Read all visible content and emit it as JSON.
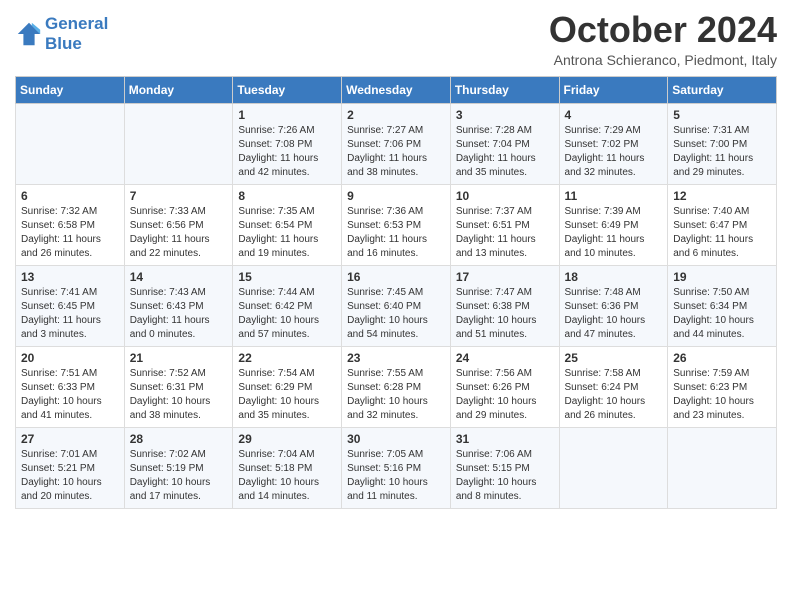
{
  "logo": {
    "line1": "General",
    "line2": "Blue"
  },
  "title": "October 2024",
  "subtitle": "Antrona Schieranco, Piedmont, Italy",
  "days_of_week": [
    "Sunday",
    "Monday",
    "Tuesday",
    "Wednesday",
    "Thursday",
    "Friday",
    "Saturday"
  ],
  "weeks": [
    [
      {
        "day": null,
        "sunrise": null,
        "sunset": null,
        "daylight": null
      },
      {
        "day": null,
        "sunrise": null,
        "sunset": null,
        "daylight": null
      },
      {
        "day": "1",
        "sunrise": "Sunrise: 7:26 AM",
        "sunset": "Sunset: 7:08 PM",
        "daylight": "Daylight: 11 hours and 42 minutes."
      },
      {
        "day": "2",
        "sunrise": "Sunrise: 7:27 AM",
        "sunset": "Sunset: 7:06 PM",
        "daylight": "Daylight: 11 hours and 38 minutes."
      },
      {
        "day": "3",
        "sunrise": "Sunrise: 7:28 AM",
        "sunset": "Sunset: 7:04 PM",
        "daylight": "Daylight: 11 hours and 35 minutes."
      },
      {
        "day": "4",
        "sunrise": "Sunrise: 7:29 AM",
        "sunset": "Sunset: 7:02 PM",
        "daylight": "Daylight: 11 hours and 32 minutes."
      },
      {
        "day": "5",
        "sunrise": "Sunrise: 7:31 AM",
        "sunset": "Sunset: 7:00 PM",
        "daylight": "Daylight: 11 hours and 29 minutes."
      }
    ],
    [
      {
        "day": "6",
        "sunrise": "Sunrise: 7:32 AM",
        "sunset": "Sunset: 6:58 PM",
        "daylight": "Daylight: 11 hours and 26 minutes."
      },
      {
        "day": "7",
        "sunrise": "Sunrise: 7:33 AM",
        "sunset": "Sunset: 6:56 PM",
        "daylight": "Daylight: 11 hours and 22 minutes."
      },
      {
        "day": "8",
        "sunrise": "Sunrise: 7:35 AM",
        "sunset": "Sunset: 6:54 PM",
        "daylight": "Daylight: 11 hours and 19 minutes."
      },
      {
        "day": "9",
        "sunrise": "Sunrise: 7:36 AM",
        "sunset": "Sunset: 6:53 PM",
        "daylight": "Daylight: 11 hours and 16 minutes."
      },
      {
        "day": "10",
        "sunrise": "Sunrise: 7:37 AM",
        "sunset": "Sunset: 6:51 PM",
        "daylight": "Daylight: 11 hours and 13 minutes."
      },
      {
        "day": "11",
        "sunrise": "Sunrise: 7:39 AM",
        "sunset": "Sunset: 6:49 PM",
        "daylight": "Daylight: 11 hours and 10 minutes."
      },
      {
        "day": "12",
        "sunrise": "Sunrise: 7:40 AM",
        "sunset": "Sunset: 6:47 PM",
        "daylight": "Daylight: 11 hours and 6 minutes."
      }
    ],
    [
      {
        "day": "13",
        "sunrise": "Sunrise: 7:41 AM",
        "sunset": "Sunset: 6:45 PM",
        "daylight": "Daylight: 11 hours and 3 minutes."
      },
      {
        "day": "14",
        "sunrise": "Sunrise: 7:43 AM",
        "sunset": "Sunset: 6:43 PM",
        "daylight": "Daylight: 11 hours and 0 minutes."
      },
      {
        "day": "15",
        "sunrise": "Sunrise: 7:44 AM",
        "sunset": "Sunset: 6:42 PM",
        "daylight": "Daylight: 10 hours and 57 minutes."
      },
      {
        "day": "16",
        "sunrise": "Sunrise: 7:45 AM",
        "sunset": "Sunset: 6:40 PM",
        "daylight": "Daylight: 10 hours and 54 minutes."
      },
      {
        "day": "17",
        "sunrise": "Sunrise: 7:47 AM",
        "sunset": "Sunset: 6:38 PM",
        "daylight": "Daylight: 10 hours and 51 minutes."
      },
      {
        "day": "18",
        "sunrise": "Sunrise: 7:48 AM",
        "sunset": "Sunset: 6:36 PM",
        "daylight": "Daylight: 10 hours and 47 minutes."
      },
      {
        "day": "19",
        "sunrise": "Sunrise: 7:50 AM",
        "sunset": "Sunset: 6:34 PM",
        "daylight": "Daylight: 10 hours and 44 minutes."
      }
    ],
    [
      {
        "day": "20",
        "sunrise": "Sunrise: 7:51 AM",
        "sunset": "Sunset: 6:33 PM",
        "daylight": "Daylight: 10 hours and 41 minutes."
      },
      {
        "day": "21",
        "sunrise": "Sunrise: 7:52 AM",
        "sunset": "Sunset: 6:31 PM",
        "daylight": "Daylight: 10 hours and 38 minutes."
      },
      {
        "day": "22",
        "sunrise": "Sunrise: 7:54 AM",
        "sunset": "Sunset: 6:29 PM",
        "daylight": "Daylight: 10 hours and 35 minutes."
      },
      {
        "day": "23",
        "sunrise": "Sunrise: 7:55 AM",
        "sunset": "Sunset: 6:28 PM",
        "daylight": "Daylight: 10 hours and 32 minutes."
      },
      {
        "day": "24",
        "sunrise": "Sunrise: 7:56 AM",
        "sunset": "Sunset: 6:26 PM",
        "daylight": "Daylight: 10 hours and 29 minutes."
      },
      {
        "day": "25",
        "sunrise": "Sunrise: 7:58 AM",
        "sunset": "Sunset: 6:24 PM",
        "daylight": "Daylight: 10 hours and 26 minutes."
      },
      {
        "day": "26",
        "sunrise": "Sunrise: 7:59 AM",
        "sunset": "Sunset: 6:23 PM",
        "daylight": "Daylight: 10 hours and 23 minutes."
      }
    ],
    [
      {
        "day": "27",
        "sunrise": "Sunrise: 7:01 AM",
        "sunset": "Sunset: 5:21 PM",
        "daylight": "Daylight: 10 hours and 20 minutes."
      },
      {
        "day": "28",
        "sunrise": "Sunrise: 7:02 AM",
        "sunset": "Sunset: 5:19 PM",
        "daylight": "Daylight: 10 hours and 17 minutes."
      },
      {
        "day": "29",
        "sunrise": "Sunrise: 7:04 AM",
        "sunset": "Sunset: 5:18 PM",
        "daylight": "Daylight: 10 hours and 14 minutes."
      },
      {
        "day": "30",
        "sunrise": "Sunrise: 7:05 AM",
        "sunset": "Sunset: 5:16 PM",
        "daylight": "Daylight: 10 hours and 11 minutes."
      },
      {
        "day": "31",
        "sunrise": "Sunrise: 7:06 AM",
        "sunset": "Sunset: 5:15 PM",
        "daylight": "Daylight: 10 hours and 8 minutes."
      },
      {
        "day": null,
        "sunrise": null,
        "sunset": null,
        "daylight": null
      },
      {
        "day": null,
        "sunrise": null,
        "sunset": null,
        "daylight": null
      }
    ]
  ]
}
